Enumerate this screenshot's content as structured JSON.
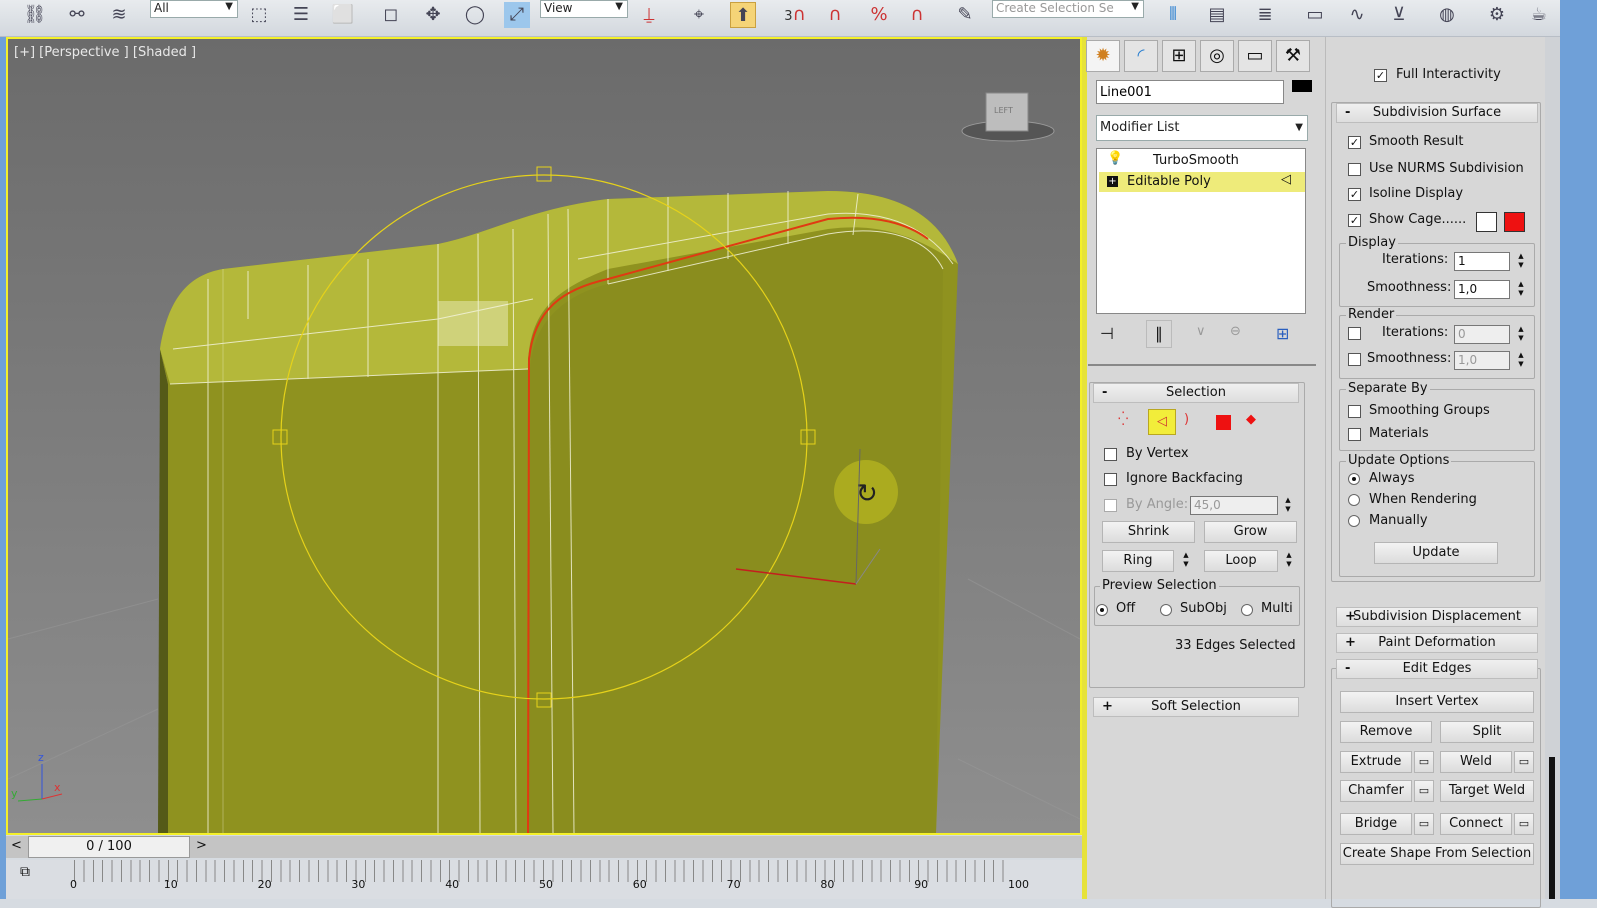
{
  "toolbar": {
    "selection_filter": "All",
    "reference_coord": "View",
    "named_selection_placeholder": "Create Selection Se",
    "snap_label": "3"
  },
  "viewport": {
    "label": "[+] [Perspective ] [Shaded ]",
    "viewcube_label": "LEFT",
    "object_color": "#a4a829",
    "selection_color": "#e03a12"
  },
  "timeslider": {
    "prev": "<",
    "frame": "0 / 100",
    "next": ">"
  },
  "ruler": {
    "ticks": [
      "0",
      "10",
      "20",
      "30",
      "40",
      "50",
      "60",
      "70",
      "80",
      "90",
      "100"
    ]
  },
  "command_panel": {
    "object_name": "Line001",
    "object_color": "#000000",
    "modifier_list": "Modifier List",
    "stack": [
      {
        "label": "TurboSmooth",
        "selected": false
      },
      {
        "label": "Editable Poly",
        "selected": true
      }
    ],
    "selection": {
      "title": "Selection",
      "by_vertex": "By Vertex",
      "ignore_backfacing": "Ignore Backfacing",
      "by_angle": "By Angle:",
      "by_angle_value": "45,0",
      "shrink": "Shrink",
      "grow": "Grow",
      "ring": "Ring",
      "loop": "Loop",
      "preview_selection": "Preview Selection",
      "preview_options": [
        "Off",
        "SubObj",
        "Multi"
      ],
      "preview_selected": "Off",
      "status": "33 Edges Selected"
    },
    "soft_selection": "Soft Selection"
  },
  "right_panel": {
    "full_interactivity": "Full Interactivity",
    "subdivision_surface": {
      "title": "Subdivision Surface",
      "smooth_result": "Smooth Result",
      "smooth_result_checked": true,
      "use_nurms": "Use NURMS Subdivision",
      "use_nurms_checked": false,
      "isoline_display": "Isoline Display",
      "isoline_checked": true,
      "show_cage": "Show Cage......",
      "show_cage_checked": true,
      "cage_colors": [
        "#ffffff",
        "#ee1111"
      ],
      "display": "Display",
      "iterations": "Iterations:",
      "iterations_value": "1",
      "smoothness": "Smoothness:",
      "smoothness_value": "1,0",
      "render": "Render",
      "render_iterations_value": "0",
      "render_smoothness_value": "1,0",
      "separate_by": "Separate By",
      "smoothing_groups": "Smoothing Groups",
      "materials": "Materials",
      "update_options": "Update Options",
      "update_choices": [
        "Always",
        "When Rendering",
        "Manually"
      ],
      "update_selected": "Always",
      "update": "Update"
    },
    "subdivision_displacement": "Subdivision Displacement",
    "paint_deformation": "Paint Deformation",
    "edit_edges": {
      "title": "Edit Edges",
      "insert_vertex": "Insert Vertex",
      "remove": "Remove",
      "split": "Split",
      "extrude": "Extrude",
      "weld": "Weld",
      "chamfer": "Chamfer",
      "target_weld": "Target Weld",
      "bridge": "Bridge",
      "connect": "Connect",
      "create_shape": "Create Shape From Selection"
    }
  }
}
